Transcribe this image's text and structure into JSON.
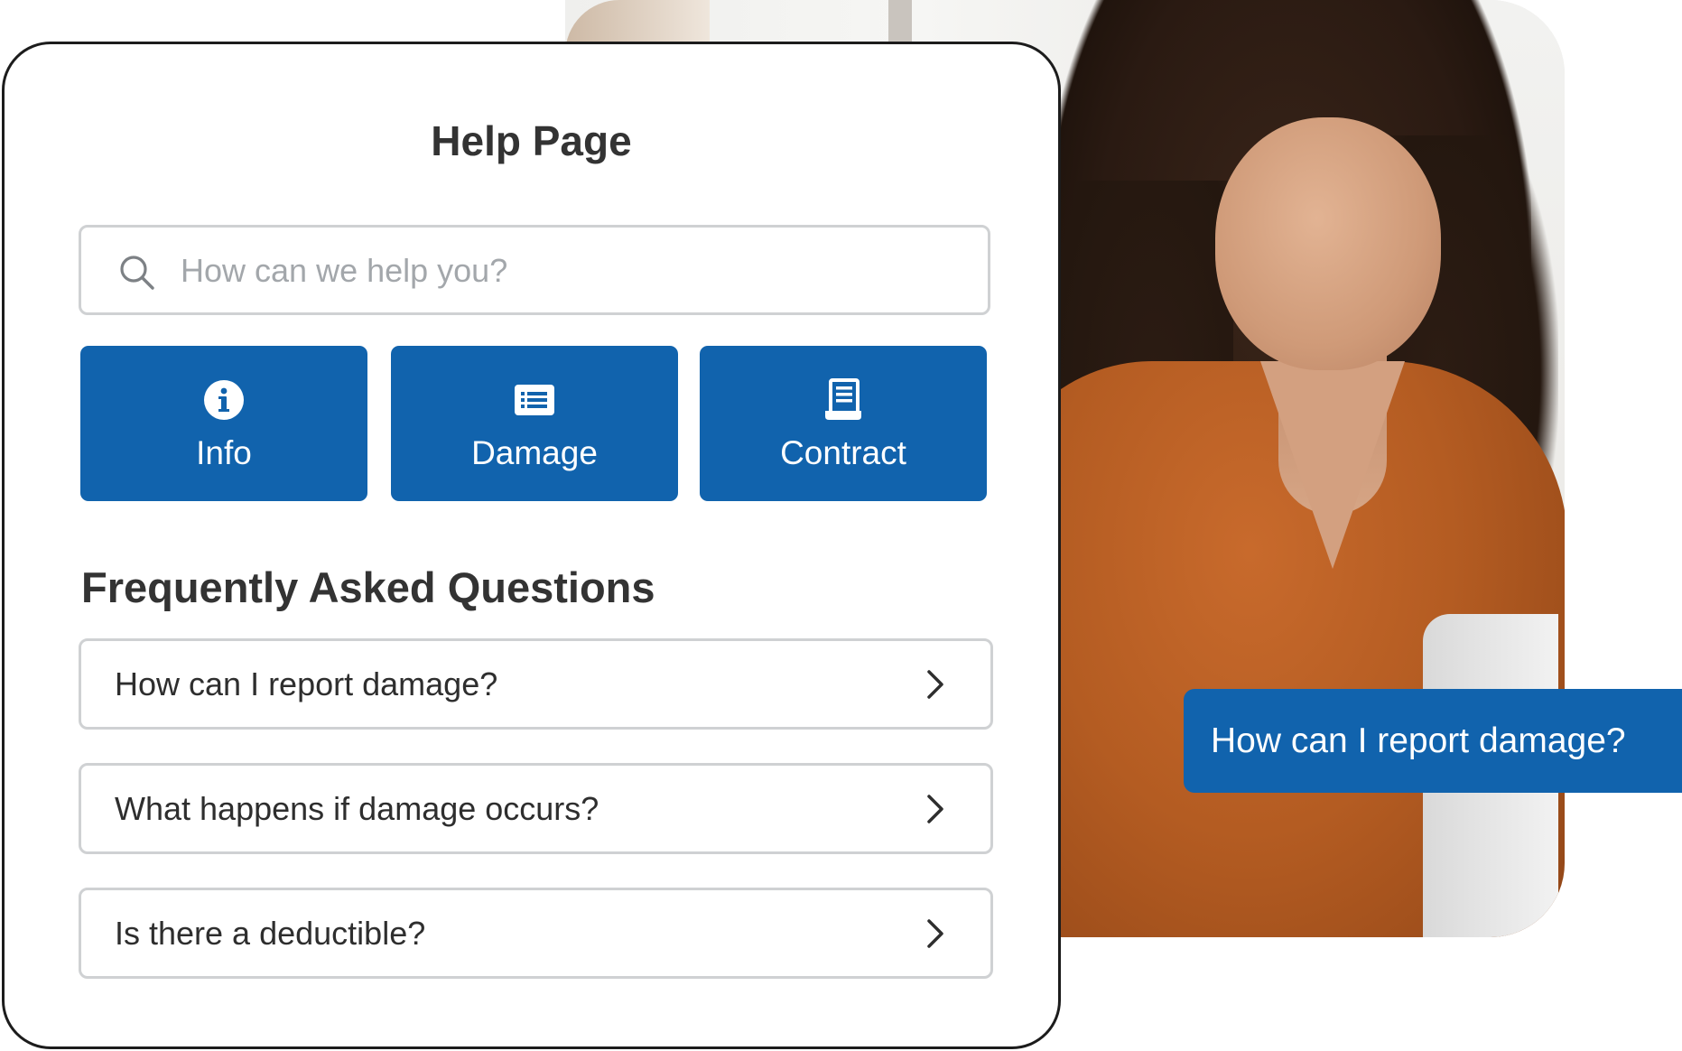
{
  "help_card": {
    "title": "Help Page",
    "search": {
      "placeholder": "How can we help you?",
      "value": ""
    },
    "tiles": [
      {
        "label": "Info",
        "icon": "info-icon"
      },
      {
        "label": "Damage",
        "icon": "list-card-icon"
      },
      {
        "label": "Contract",
        "icon": "contract-document-icon"
      }
    ],
    "faq_heading": "Frequently Asked Questions",
    "faq_items": [
      {
        "question": "How can I report damage?"
      },
      {
        "question": "What happens if damage occurs?"
      },
      {
        "question": "Is there a deductible?"
      }
    ]
  },
  "chat_bubble": {
    "text": "How can I report damage?"
  },
  "colors": {
    "accent": "#1163ad",
    "border": "#cfd1d3",
    "text": "#2e2e2e",
    "placeholder": "#a3a7ab"
  }
}
